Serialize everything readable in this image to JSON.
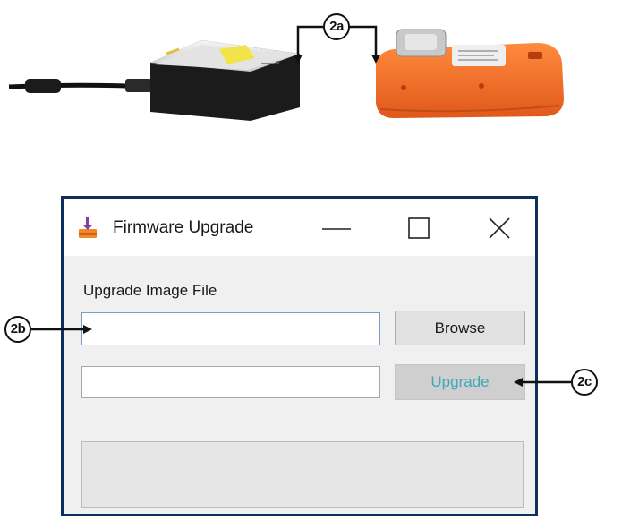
{
  "window": {
    "title": "Firmware Upgrade",
    "controls": {
      "minimize": "—",
      "maximize": "☐",
      "close": "✕"
    }
  },
  "form": {
    "file_label": "Upgrade Image File",
    "path_value": "",
    "status_value": "",
    "browse_label": "Browse",
    "upgrade_label": "Upgrade"
  },
  "progress": {
    "value": 0
  },
  "callouts": {
    "a": "2a",
    "b": "2b",
    "c": "2c"
  },
  "colors": {
    "window_border": "#0e2f5e",
    "upgrade_text": "#3fa9b8",
    "device_orange": "#f26b21",
    "adapter_black": "#1b1b1b"
  },
  "icons": [
    "firmware-upgrade-app-icon",
    "minimize-icon",
    "maximize-icon",
    "close-icon"
  ]
}
